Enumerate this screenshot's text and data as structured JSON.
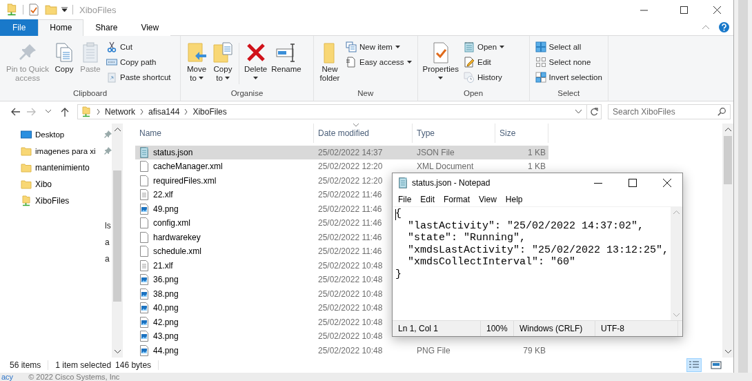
{
  "title_bar": {
    "title": "XiboFiles"
  },
  "ribbon_tabs": [
    {
      "label": "File",
      "kind": "menu",
      "selected": false
    },
    {
      "label": "Home",
      "kind": "tab",
      "selected": true
    },
    {
      "label": "Share",
      "kind": "tab",
      "selected": false
    },
    {
      "label": "View",
      "kind": "tab",
      "selected": false
    }
  ],
  "ribbon_groups": [
    {
      "label": "Clipboard",
      "items": [
        {
          "kind": "large",
          "lines": [
            "Pin to Quick",
            "access"
          ],
          "disabled": true,
          "dropdown": false
        },
        {
          "kind": "large",
          "lines": [
            "Copy"
          ],
          "disabled": false,
          "dropdown": false
        },
        {
          "kind": "large",
          "lines": [
            "Paste"
          ],
          "disabled": true,
          "dropdown": false
        },
        {
          "kind": "stack",
          "items": [
            {
              "label": "Cut",
              "disabled": false,
              "dropdown": false
            },
            {
              "label": "Copy path",
              "disabled": false,
              "dropdown": false
            },
            {
              "label": "Paste shortcut",
              "disabled": true,
              "dropdown": false
            }
          ]
        }
      ]
    },
    {
      "label": "Organise",
      "items": [
        {
          "kind": "large",
          "lines": [
            "Move",
            "to"
          ],
          "disabled": false,
          "dropdown": true
        },
        {
          "kind": "large",
          "lines": [
            "Copy",
            "to"
          ],
          "disabled": false,
          "dropdown": true
        },
        {
          "kind": "separator"
        },
        {
          "kind": "large",
          "lines": [
            "Delete"
          ],
          "disabled": false,
          "dropdown": true
        },
        {
          "kind": "large",
          "lines": [
            "Rename"
          ],
          "disabled": false,
          "dropdown": false
        }
      ]
    },
    {
      "label": "New",
      "items": [
        {
          "kind": "large",
          "lines": [
            "New",
            "folder"
          ],
          "disabled": false,
          "dropdown": false
        },
        {
          "kind": "stack",
          "items": [
            {
              "label": "New item",
              "disabled": false,
              "dropdown": true
            },
            {
              "label": "Easy access",
              "disabled": false,
              "dropdown": true
            }
          ]
        }
      ]
    },
    {
      "label": "Open",
      "items": [
        {
          "kind": "large",
          "lines": [
            "Properties"
          ],
          "disabled": false,
          "dropdown": true
        },
        {
          "kind": "stack",
          "items": [
            {
              "label": "Open",
              "disabled": false,
              "dropdown": true
            },
            {
              "label": "Edit",
              "disabled": false,
              "dropdown": false
            },
            {
              "label": "History",
              "disabled": true,
              "dropdown": false
            }
          ]
        }
      ]
    },
    {
      "label": "Select",
      "items": [
        {
          "kind": "stack",
          "items": [
            {
              "label": "Select all",
              "disabled": false,
              "dropdown": false
            },
            {
              "label": "Select none",
              "disabled": false,
              "dropdown": false
            },
            {
              "label": "Invert selection",
              "disabled": false,
              "dropdown": false
            }
          ]
        }
      ]
    }
  ],
  "address_bar": {
    "breadcrumbs": [
      "Network",
      "afisa144",
      "XiboFiles"
    ],
    "search": {
      "placeholder": "Search XiboFiles"
    }
  },
  "navigation_pane": {
    "items": [
      {
        "label": "Desktop",
        "kind": "desktop",
        "pinned": true
      },
      {
        "label": "imagenes para xi",
        "kind": "folder",
        "pinned": true
      },
      {
        "label": "mantenimiento",
        "kind": "folder",
        "pinned": false
      },
      {
        "label": "Xibo",
        "kind": "folder",
        "pinned": false
      },
      {
        "label": "XiboFiles",
        "kind": "network",
        "pinned": false
      }
    ],
    "fragments": [
      "ls",
      "a",
      "a"
    ]
  },
  "file_list": {
    "columns": [
      {
        "label": "Name",
        "sorted": false
      },
      {
        "label": "Date modified",
        "sorted": true
      },
      {
        "label": "Type",
        "sorted": false
      },
      {
        "label": "Size",
        "sorted": false
      }
    ],
    "rows": [
      {
        "name": "status.json",
        "date": "25/02/2022 14:37",
        "type": "JSON File",
        "size": "1 KB",
        "kind": "notepad",
        "selected": true
      },
      {
        "name": "cacheManager.xml",
        "date": "25/02/2022 12:20",
        "type": "XML Document",
        "size": "1 KB",
        "kind": "document",
        "selected": false
      },
      {
        "name": "requiredFiles.xml",
        "date": "25/02/2022 12:20",
        "kind": "document",
        "selected": false
      },
      {
        "name": "22.xlf",
        "date": "25/02/2022 11:46",
        "kind": "text",
        "selected": false
      },
      {
        "name": "49.png",
        "date": "25/02/2022 11:46",
        "kind": "image",
        "selected": false
      },
      {
        "name": "config.xml",
        "date": "25/02/2022 11:46",
        "kind": "document",
        "selected": false
      },
      {
        "name": "hardwarekey",
        "date": "25/02/2022 11:46",
        "kind": "document",
        "selected": false
      },
      {
        "name": "schedule.xml",
        "date": "25/02/2022 11:46",
        "kind": "document",
        "selected": false
      },
      {
        "name": "21.xlf",
        "date": "25/02/2022 10:48",
        "kind": "text",
        "selected": false
      },
      {
        "name": "36.png",
        "date": "25/02/2022 10:48",
        "kind": "image",
        "selected": false
      },
      {
        "name": "38.png",
        "date": "25/02/2022 10:48",
        "kind": "image",
        "selected": false
      },
      {
        "name": "40.png",
        "date": "25/02/2022 10:48",
        "kind": "image",
        "selected": false
      },
      {
        "name": "42.png",
        "date": "25/02/2022 10:48",
        "kind": "image",
        "selected": false
      },
      {
        "name": "43.png",
        "date": "25/02/2022 10:48",
        "kind": "image",
        "selected": false
      },
      {
        "name": "44.png",
        "date": "25/02/2022 10:48",
        "type": "PNG File",
        "size": "79 KB",
        "kind": "image",
        "selected": false
      }
    ]
  },
  "status_bar": {
    "item_count": "56 items",
    "selection": "1 item selected",
    "size": "146 bytes",
    "views": [
      {
        "kind": "details",
        "selected": true
      },
      {
        "kind": "large_icons",
        "selected": false
      }
    ]
  },
  "notepad": {
    "title": "status.json - Notepad",
    "menu": [
      "File",
      "Edit",
      "Format",
      "View",
      "Help"
    ],
    "lines": [
      "{",
      "  \"lastActivity\": \"25/02/2022 14:37:02\",",
      "  \"state\": \"Running\",",
      "  \"xmdsLastActivity\": \"25/02/2022 13:12:25\",",
      "  \"xmdsCollectInterval\": \"60\"",
      "}"
    ],
    "status": [
      "Ln 1, Col 1",
      "100%",
      "Windows (CRLF)",
      "UTF-8"
    ]
  },
  "background_page": {
    "link": "acy",
    "footer": "© 2022 Cisco Systems, Inc"
  }
}
